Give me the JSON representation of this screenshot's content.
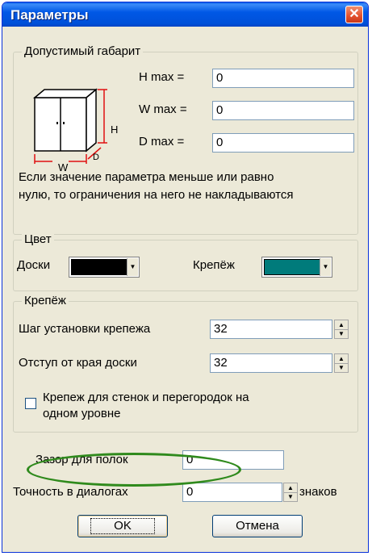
{
  "window": {
    "title": "Параметры",
    "close_symbol": "✕"
  },
  "dimensions_group": {
    "legend": "Допустимый габарит",
    "cabinet_labels": {
      "h": "H",
      "w": "W",
      "d": "D"
    },
    "h_max_label": "H max =",
    "h_max_value": "0",
    "w_max_label": "W max =",
    "w_max_value": "0",
    "d_max_label": "D max =",
    "d_max_value": "0",
    "note_line1": "Если значение параметра меньше или равно",
    "note_line2": "нулю, то ограничения на него не накладываются"
  },
  "color_group": {
    "legend": "Цвет",
    "boards_label": "Доски",
    "boards_color": "#000000",
    "fasteners_label": "Крепёж",
    "fasteners_color": "#007b7b"
  },
  "fasteners_group": {
    "legend": "Крепёж",
    "step_label": "Шаг установки крепежа",
    "step_value": "32",
    "offset_label": "Отступ от края доски",
    "offset_value": "32",
    "same_level_line1": "Крепеж для стенок и перегородок на",
    "same_level_line2": "одном уровне",
    "same_level_checked": false
  },
  "bottom": {
    "shelf_gap_label": "Зазор для полок",
    "shelf_gap_value": "0",
    "precision_label": "Точность в диалогах",
    "precision_value": "0",
    "precision_unit": "знаков"
  },
  "buttons": {
    "ok": "OK",
    "cancel": "Отмена"
  },
  "accent_colors": {
    "titlebar": "#0058e6",
    "highlight": "#2f8a1c",
    "dimension_marks": "#e01010"
  }
}
